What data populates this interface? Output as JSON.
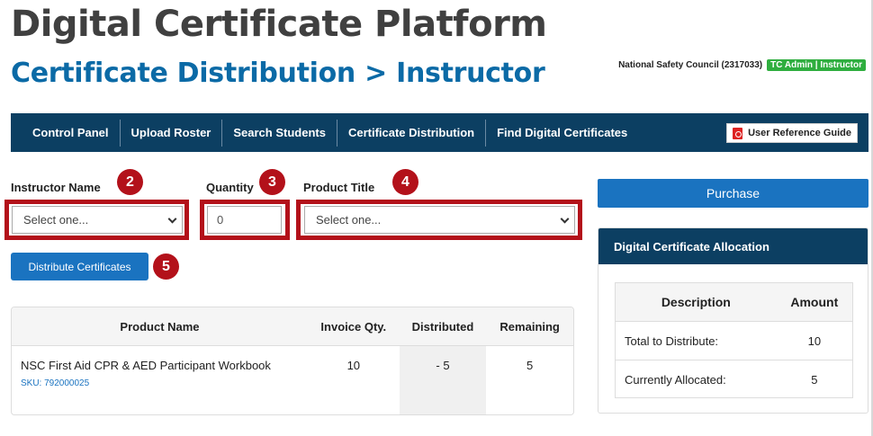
{
  "header": {
    "app_title": "Digital Certificate Platform",
    "page_title": "Certificate Distribution > Instructor",
    "organization": "National Safety Council (2317033)",
    "role_badge": "TC Admin | Instructor"
  },
  "nav": {
    "items": [
      {
        "label": "Control Panel"
      },
      {
        "label": "Upload Roster"
      },
      {
        "label": "Search Students"
      },
      {
        "label": "Certificate Distribution"
      },
      {
        "label": "Find Digital Certificates"
      }
    ],
    "reference_guide": "User Reference Guide"
  },
  "form": {
    "instructor_label": "Instructor Name",
    "instructor_value": "Select one...",
    "quantity_label": "Quantity",
    "quantity_value": "0",
    "product_label": "Product Title",
    "product_value": "Select one...",
    "distribute_button": "Distribute Certificates"
  },
  "markers": [
    "2",
    "3",
    "4",
    "5"
  ],
  "products_table": {
    "headers": [
      "Product Name",
      "Invoice Qty.",
      "Distributed",
      "Remaining"
    ],
    "rows": [
      {
        "name": "NSC First Aid CPR & AED Participant Workbook",
        "sku": "SKU: 792000025",
        "invoice_qty": "10",
        "distributed": "- 5",
        "remaining": "5"
      }
    ]
  },
  "purchase_button": "Purchase",
  "allocation": {
    "title": "Digital Certificate Allocation",
    "headers": [
      "Description",
      "Amount"
    ],
    "rows": [
      {
        "description": "Total to Distribute:",
        "amount": "10"
      },
      {
        "description": "Currently Allocated:",
        "amount": "5"
      }
    ]
  },
  "colors": {
    "navy": "#0c3f62",
    "blue": "#1a73c0",
    "title_blue": "#0b6aa6",
    "marker_red": "#b3111a",
    "badge_green": "#2fae3f"
  }
}
